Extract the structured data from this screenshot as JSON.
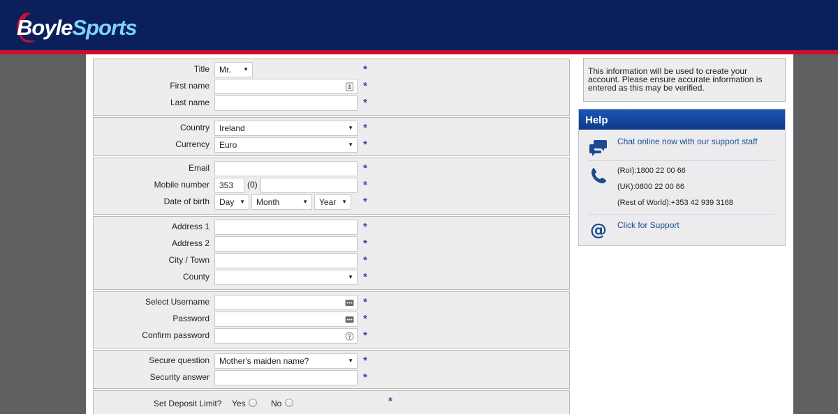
{
  "header": {
    "logo_part1": "Boyle",
    "logo_part2": "Sports",
    "brand_red": "#c8102e",
    "brand_blue": "#0b1f5c"
  },
  "form": {
    "title": {
      "label": "Title",
      "value": "Mr."
    },
    "first_name": {
      "label": "First name",
      "value": ""
    },
    "last_name": {
      "label": "Last name",
      "value": ""
    },
    "country": {
      "label": "Country",
      "value": "Ireland"
    },
    "currency": {
      "label": "Currency",
      "value": "Euro"
    },
    "email": {
      "label": "Email",
      "value": ""
    },
    "mobile": {
      "label": "Mobile number",
      "prefix": "353",
      "zero": "(0)",
      "value": ""
    },
    "dob": {
      "label": "Date of birth",
      "day": "Day",
      "month": "Month",
      "year": "Year"
    },
    "address1": {
      "label": "Address 1",
      "value": ""
    },
    "address2": {
      "label": "Address 2",
      "value": ""
    },
    "city": {
      "label": "City / Town",
      "value": ""
    },
    "county": {
      "label": "County",
      "value": ""
    },
    "username": {
      "label": "Select Username",
      "value": ""
    },
    "password": {
      "label": "Password",
      "value": ""
    },
    "confirm_password": {
      "label": "Confirm password",
      "value": ""
    },
    "secure_question": {
      "label": "Secure question",
      "value": "Mother's maiden name?"
    },
    "security_answer": {
      "label": "Security answer",
      "value": ""
    },
    "deposit_limit": {
      "label": "Set Deposit Limit?",
      "yes": "Yes",
      "no": "No"
    },
    "required_mark": "*"
  },
  "info": {
    "text": "This information will be used to create your account. Please ensure accurate information is entered as this may be verified."
  },
  "help": {
    "title": "Help",
    "chat_link": "Chat online now with our support staff",
    "phone_roi": "(RoI):1800 22 00 66",
    "phone_uk": "(UK):0800 22 00 66",
    "phone_row": "(Rest of World):+353 42 939 3168",
    "support_link": "Click for Support"
  }
}
